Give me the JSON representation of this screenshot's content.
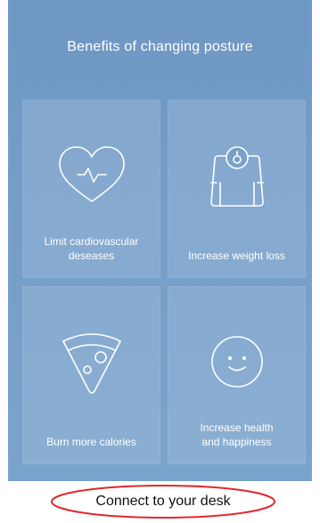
{
  "benefits": {
    "title": "Benefits of changing posture",
    "cards": [
      {
        "label": "Limit cardiovascular\ndeseases",
        "icon": "heart-pulse-icon"
      },
      {
        "label": "Increase weight loss",
        "icon": "scale-icon"
      },
      {
        "label": "Burn more calories",
        "icon": "pizza-slice-icon"
      },
      {
        "label": "Increase health\nand happiness",
        "icon": "smiley-face-icon"
      }
    ]
  },
  "action": {
    "connect_label": "Connect to your desk",
    "highlight_color": "#e0292e"
  },
  "colors": {
    "panel_top": "#6e97c4",
    "panel_bottom": "#7aa3cd",
    "text": "#ffffff"
  }
}
